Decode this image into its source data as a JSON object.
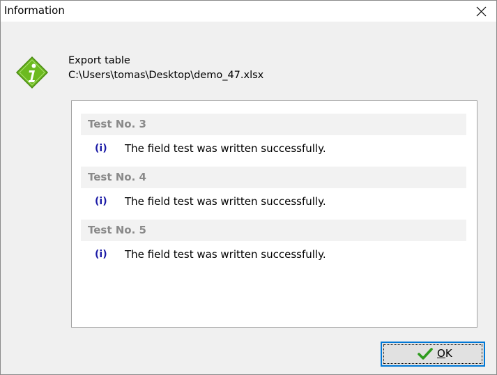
{
  "window": {
    "title": "Information",
    "close_icon": "close-icon"
  },
  "header": {
    "icon": "info-diamond-icon",
    "icon_color": "#6cba1f",
    "line1": "Export table",
    "line2": "C:\\Users\\tomas\\Desktop\\demo_47.xlsx"
  },
  "messages": [
    {
      "title": "Test No. 3",
      "icon_text": "(i)",
      "text": "The field test was written successfully."
    },
    {
      "title": "Test No. 4",
      "icon_text": "(i)",
      "text": "The field test was written successfully."
    },
    {
      "title": "Test No. 5",
      "icon_text": "(i)",
      "text": "The field test was written successfully."
    }
  ],
  "buttons": {
    "ok_mnemonic": "O",
    "ok_rest": "K",
    "ok_icon": "checkmark-icon"
  },
  "colors": {
    "accent": "#0078d7",
    "info_text": "#1a1aa6",
    "group_header_text": "#8a8a8a"
  }
}
